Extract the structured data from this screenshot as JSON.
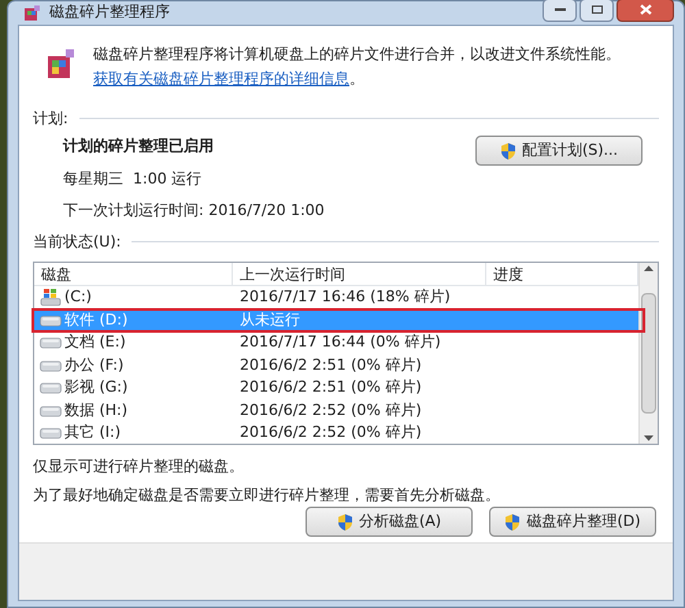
{
  "window": {
    "title": "磁盘碎片整理程序"
  },
  "intro": {
    "text": "磁盘碎片整理程序将计算机硬盘上的碎片文件进行合并，以改进文件系统性能。",
    "link": "获取有关磁盘碎片整理程序的详细信息",
    "end": "。"
  },
  "schedule": {
    "heading": "计划:",
    "status": "计划的碎片整理已启用",
    "when": "每星期三  1:00 运行",
    "next": "下一次计划运行时间: 2016/7/20 1:00",
    "button": "配置计划(S)..."
  },
  "current": {
    "heading": "当前状态(U):"
  },
  "table": {
    "columns": [
      "磁盘",
      "上一次运行时间",
      "进度"
    ],
    "rows": [
      {
        "kind": "system",
        "disk": "(C:)",
        "last_run": "2016/7/17 16:46 (18% 碎片)",
        "selected": false
      },
      {
        "kind": "drive",
        "disk": "软件 (D:)",
        "last_run": "从未运行",
        "selected": true
      },
      {
        "kind": "drive",
        "disk": "文档 (E:)",
        "last_run": "2016/7/17 16:44 (0% 碎片)",
        "selected": false
      },
      {
        "kind": "drive",
        "disk": "办公 (F:)",
        "last_run": "2016/6/2 2:51 (0% 碎片)",
        "selected": false
      },
      {
        "kind": "drive",
        "disk": "影视 (G:)",
        "last_run": "2016/6/2 2:51 (0% 碎片)",
        "selected": false
      },
      {
        "kind": "drive",
        "disk": "数据 (H:)",
        "last_run": "2016/6/2 2:52 (0% 碎片)",
        "selected": false
      },
      {
        "kind": "drive",
        "disk": "其它 (I:)",
        "last_run": "2016/6/2 2:52 (0% 碎片)",
        "selected": false
      }
    ]
  },
  "notes": [
    "仅显示可进行碎片整理的磁盘。",
    "为了最好地确定磁盘是否需要立即进行碎片整理，需要首先分析磁盘。"
  ],
  "buttons": [
    "分析磁盘(A)",
    "磁盘碎片整理(D)"
  ]
}
